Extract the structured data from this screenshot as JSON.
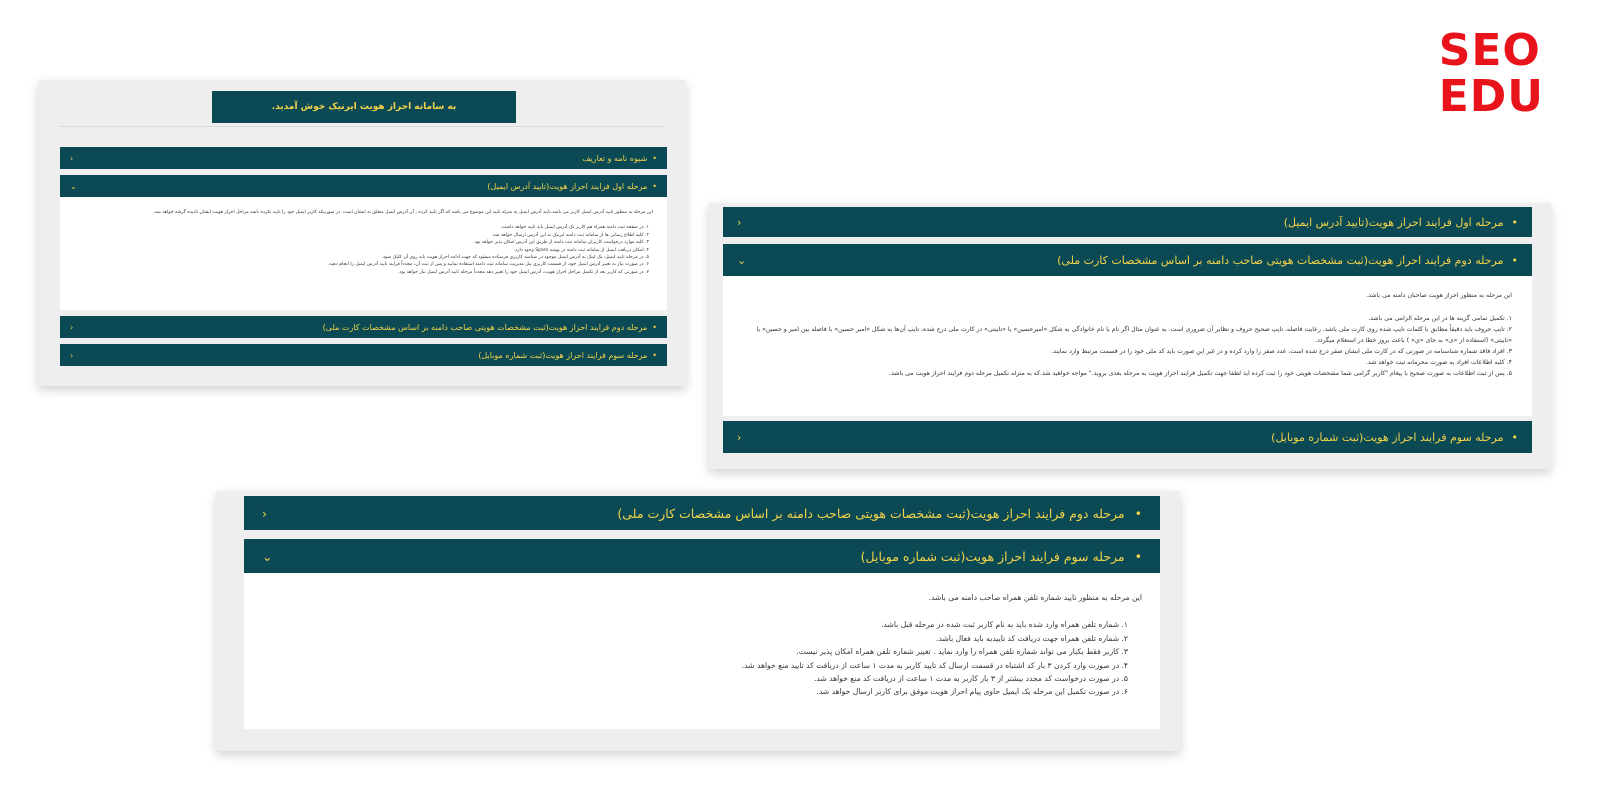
{
  "logo": {
    "line1": "SEO",
    "line2": "EDU",
    "color": "#e8131b"
  },
  "colors": {
    "header_bg": "#0b4a55",
    "header_text": "#f3d34a",
    "card_bg": "#eeeeee"
  },
  "panel1": {
    "welcome": "به سامانه احراز هویت ایرنیک خوش آمدید.",
    "items": [
      {
        "label": "شیوه نامه و تعاریف",
        "expanded": false
      },
      {
        "label": "مرحله اول فرایند احراز هویت(تایید آدرس ایمیل)",
        "expanded": true
      },
      {
        "label": "مرحله دوم فرایند احراز هویت(ثبت مشخصات هویتی صاحب دامنه بر اساس مشخصات کارت ملی)",
        "expanded": false
      },
      {
        "label": "مرحله سوم فرایند احراز هویت(ثبت شماره موبایل)",
        "expanded": false
      }
    ],
    "body_intro": "این مرحله به منظور تایید آدرس ایمیل کاربر می باشد.تایید آدرس ایمیل به منزله تایید این موضوع می باشد که اگر تایید کرده ، آن آدرس ایمیل متعلق به ایشان است. در صورتیکه کاربر ایمیل خود را تایید نکرده باشد مراحل احراز هویت ایشان نادیده گرفته خواهد شد.",
    "body_items": [
      "۱. در صفحه ثبت دامنه همراه هم کاربر یک آدرس ایمیل باید تایید خواهد داشت.",
      "۲. کلیه اطلاع رسانی ها از سامانه ثبت دامنه ایرنیک به این آدرس ارسال خواهد شد.",
      "۳. کلیه موارد درخواست کاربران سامانه ثبت دامنه از طریق این آدرس امکان پذیر خواهد بود.",
      "۴. امکان دریافت ایمیل از سامانه ثبت دامنه در پوشه Spam وجود دارد.",
      "۵. در مرحله تایید ایمیل، یک لینک به آدرس ایمیل موجود در شناسه کاربری فرستاده میشود که جهت ادامه احراز هویت باید روی آن کلیک شود.",
      "۶. در صورت نیاز به تغییر آدرس ایمیل خود، از قسمت کاربری پنل مدیریت سامانه ثبت دامنه استفاده نمایید و پس از ثبت آن، مجدداً فرایند تایید آدرس ایمیل را انجام دهید.",
      "۷. در صورتی که کاربر بعد از تکمیل مراحل احراز هویت، آدرس ایمیل خود را تغییر دهد مجدداً مرحله تایید آدرس ایمیل نیاز خواهد بود."
    ]
  },
  "panel2": {
    "items": [
      {
        "label": "مرحله اول فرایند احراز هویت(تایید آدرس ایمیل)",
        "expanded": false
      },
      {
        "label": "مرحله دوم فرایند احراز هویت(ثبت مشخصات هویتی صاحب دامنه بر اساس مشخصات کارت ملی)",
        "expanded": true
      },
      {
        "label": "مرحله سوم فرایند احراز هویت(ثبت شماره موبایل)",
        "expanded": false
      }
    ],
    "body_intro": "این مرحله به منظور احراز هویت صاحبان دامنه می باشد.",
    "body_items": [
      "۱. تکمیل تمامی گزینه ها در این مرحله الزامی می باشد.",
      "۲. تایپ حروف باید دقیقاً مطابق با کلمات تایپ شده روی کارت ملی باشد. رعایت فاصله، تایپ صحیح حروف و نظایر آن ضروری است. به عنوان مثال اگر نام یا نام خانوادگی به شکل «امیرحسین» یا «تابیتی» در کارت ملی درج شده، تایپ آن‌ها به شکل «امیر حسین» با فاصله بین امیر و حسین» یا «تابیتی» (استفاده از «ی» به جای «ي» ) باعث بروز خطا در استعلام میگردد.",
      "۳. افراد فاقد شماره شناسنامه در صورتی که در کارت ملی ایشان صفر درج شده است، عدد صفر را وارد کرده و در غیر این صورت باید کد ملی خود را در قسمت مرتبط وارد نمایند.",
      "۴. کلیه اطلاعات افراد به صورت محرمانه ثبت خواهد شد.",
      "۵. پس از ثبت اطلاعات به صورت صحیح با پیغام \"کاربر گرامی شما مشخصات هویتی خود را ثبت کرده اید لطفا جهت تکمیل فرایند احراز هویت به مرحله بعدی بروید.\" مواجه خواهید شد.که به منزله تکمیل مرحله دوم فرایند احراز هویت می باشد."
    ]
  },
  "panel3": {
    "items": [
      {
        "label": "مرحله دوم فرایند احراز هویت(ثبت مشخصات هویتی صاحب دامنه بر اساس مشخصات کارت ملی)",
        "expanded": false
      },
      {
        "label": "مرحله سوم فرایند احراز هویت(ثبت شماره موبایل)",
        "expanded": true
      }
    ],
    "body_intro": "این مرحله به منظور تایید شماره تلفن همراه صاحب دامنه می باشد.",
    "body_items": [
      "۱. شماره تلفن همراه وارد شده باید به نام کاربر ثبت شده در مرحله قبل باشد.",
      "۲. شماره تلفن همراه جهت دریافت کد تاییدبه باید فعال باشد.",
      "۳. کاربر فقط یکبار می تواند شماره تلفن همراه را وارد نماید . تغییر شماره تلفن همراه امکان پذیر نیست.",
      "۴. در صورت وارد کردن ۳ بار کد اشتباه در قسمت ارسال کد تایید کاربر به مدت ۱ ساعت از دریافت کد تایید منع خواهد شد.",
      "۵. در صورت درخواست کد مجدد بیشتر از ۳ بار کاربر به مدت ۱ ساعت از دریافت کد منع خواهد شد.",
      "۶. در صورت تکمیل این مرحله یک ایمیل حاوی پیام احراز هویت موفق برای کاربر ارسال خواهد شد."
    ]
  },
  "icons": {
    "bullet": "•",
    "chevron_collapsed": "›",
    "chevron_expanded": "⌄"
  }
}
